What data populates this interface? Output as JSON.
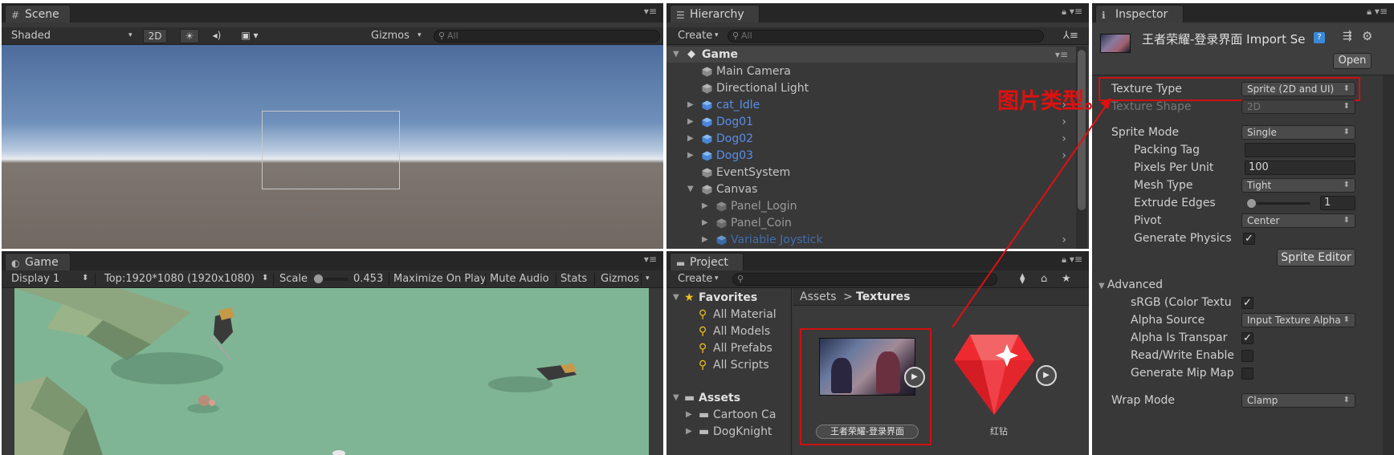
{
  "scene": {
    "tab": "Scene",
    "shading": "Shaded",
    "btn_2d": "2D",
    "gizmos": "Gizmos",
    "search_placeholder": "All"
  },
  "game": {
    "tab": "Game",
    "display": "Display 1",
    "resolution": "Top:1920*1080 (1920x1080)",
    "scale_label": "Scale",
    "scale_value": "0.453",
    "maximize": "Maximize On Play",
    "mute": "Mute Audio",
    "stats": "Stats",
    "gizmos": "Gizmos"
  },
  "hierarchy": {
    "tab": "Hierarchy",
    "create": "Create",
    "search_placeholder": "All",
    "scene_name": "Game",
    "items": [
      {
        "label": "Main Camera"
      },
      {
        "label": "Directional Light"
      },
      {
        "label": "cat_Idle"
      },
      {
        "label": "Dog01"
      },
      {
        "label": "Dog02"
      },
      {
        "label": "Dog03"
      },
      {
        "label": "EventSystem"
      },
      {
        "label": "Canvas"
      },
      {
        "label": "Panel_Login"
      },
      {
        "label": "Panel_Coin"
      },
      {
        "label": "Variable Joystick"
      }
    ]
  },
  "project": {
    "tab": "Project",
    "create": "Create",
    "favorites": "Favorites",
    "fav_items": [
      "All Material",
      "All Models",
      "All Prefabs",
      "All Scripts"
    ],
    "assets_root": "Assets",
    "asset_folders": [
      "Cartoon Ca",
      "DogKnight"
    ],
    "breadcrumb_root": "Assets",
    "breadcrumb_sep": ">",
    "breadcrumb_current": "Textures",
    "assets": [
      {
        "label": "王者荣耀-登录界面"
      },
      {
        "label": "红钻"
      }
    ]
  },
  "inspector": {
    "tab": "Inspector",
    "asset_title": "王者荣耀-登录界面 Import Se",
    "open_btn": "Open",
    "texture_type_label": "Texture Type",
    "texture_type_value": "Sprite (2D and UI)",
    "texture_shape_label": "Texture Shape",
    "texture_shape_value": "2D",
    "sprite_mode_label": "Sprite Mode",
    "sprite_mode_value": "Single",
    "packing_tag_label": "Packing Tag",
    "packing_tag_value": "",
    "ppu_label": "Pixels Per Unit",
    "ppu_value": "100",
    "mesh_type_label": "Mesh Type",
    "mesh_type_value": "Tight",
    "extrude_label": "Extrude Edges",
    "extrude_value": "1",
    "pivot_label": "Pivot",
    "pivot_value": "Center",
    "gen_physics_label": "Generate Physics",
    "sprite_editor_btn": "Sprite Editor",
    "advanced_label": "Advanced",
    "srgb_label": "sRGB (Color Textu",
    "alpha_source_label": "Alpha Source",
    "alpha_source_value": "Input Texture Alpha",
    "alpha_transparent_label": "Alpha Is Transpar",
    "readwrite_label": "Read/Write Enable",
    "mipmap_label": "Generate Mip Map",
    "wrap_mode_label": "Wrap Mode",
    "wrap_mode_value": "Clamp"
  },
  "annotation": {
    "text": "图片类型。",
    "color": "#e01010"
  }
}
